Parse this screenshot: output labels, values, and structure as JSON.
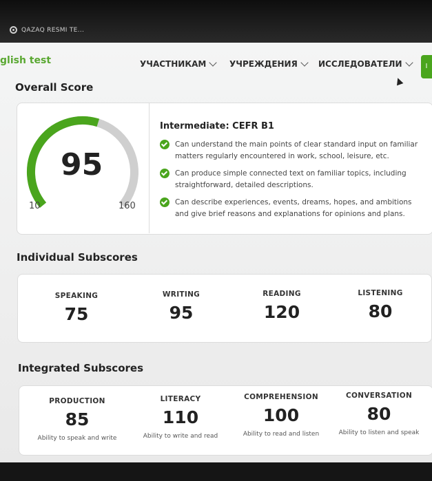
{
  "browser": {
    "tab_title": "QAZAQ RESMI TE..."
  },
  "header": {
    "site_name": "glish test",
    "nav": [
      {
        "label": "УЧАСТНИКАМ"
      },
      {
        "label": "УЧРЕЖДЕНИЯ"
      },
      {
        "label": "ИССЛЕДОВАТЕЛИ"
      }
    ],
    "cta_label": "I"
  },
  "overall": {
    "title": "Overall Score",
    "score": "95",
    "min": "10",
    "max": "160",
    "level": "Intermediate: CEFR B1",
    "descriptors": [
      "Can understand the main points of clear standard input on familiar matters regularly encountered in work, school, leisure, etc.",
      "Can produce simple connected text on familiar topics, including straightforward, detailed descriptions.",
      "Can describe experiences, events, dreams, hopes, and ambitions and give brief reasons and explanations for opinions and plans."
    ],
    "accent_color": "#4aa51d",
    "track_color": "#cfcfcf"
  },
  "individual": {
    "title": "Individual Subscores",
    "items": [
      {
        "label": "SPEAKING",
        "value": "75"
      },
      {
        "label": "WRITING",
        "value": "95"
      },
      {
        "label": "READING",
        "value": "120"
      },
      {
        "label": "LISTENING",
        "value": "80"
      }
    ]
  },
  "integrated": {
    "title": "Integrated Subscores",
    "items": [
      {
        "label": "PRODUCTION",
        "value": "85",
        "sub": "Ability to speak and write"
      },
      {
        "label": "LITERACY",
        "value": "110",
        "sub": "Ability to write and read"
      },
      {
        "label": "COMPREHENSION",
        "value": "100",
        "sub": "Ability to read and listen"
      },
      {
        "label": "CONVERSATION",
        "value": "80",
        "sub": "Ability to listen and speak"
      }
    ]
  }
}
